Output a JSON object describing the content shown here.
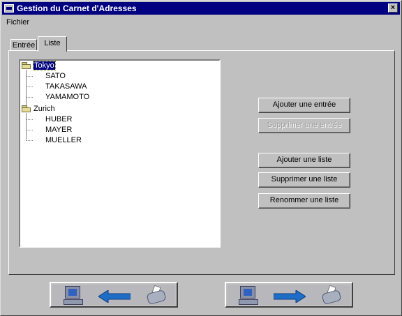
{
  "window": {
    "title": "Gestion du Carnet d'Adresses",
    "close_glyph": "×"
  },
  "menu": {
    "items": [
      "Fichier"
    ]
  },
  "tabs": [
    {
      "label": "Entrée"
    },
    {
      "label": "Liste"
    }
  ],
  "tree": {
    "groups": [
      {
        "label": "Tokyo",
        "selected": true,
        "children": [
          "SATO",
          "TAKASAWA",
          "YAMAMOTO"
        ]
      },
      {
        "label": "Zurich",
        "selected": false,
        "children": [
          "HUBER",
          "MAYER",
          "MUELLER"
        ]
      }
    ]
  },
  "buttons": {
    "add_entry": "Ajouter une entrée",
    "delete_entry": "Supprimer une entrée",
    "add_list": "Ajouter une liste",
    "delete_list": "Supprimer une liste",
    "rename_list": "Renommer une liste"
  },
  "nav": {
    "back_icons": [
      "computer-icon",
      "arrow-left-icon",
      "fax-icon"
    ],
    "forward_icons": [
      "computer-icon",
      "arrow-right-icon",
      "fax-icon"
    ]
  },
  "colors": {
    "title_bar": "#000080",
    "selection": "#000080",
    "arrow": "#1e6ec8"
  }
}
